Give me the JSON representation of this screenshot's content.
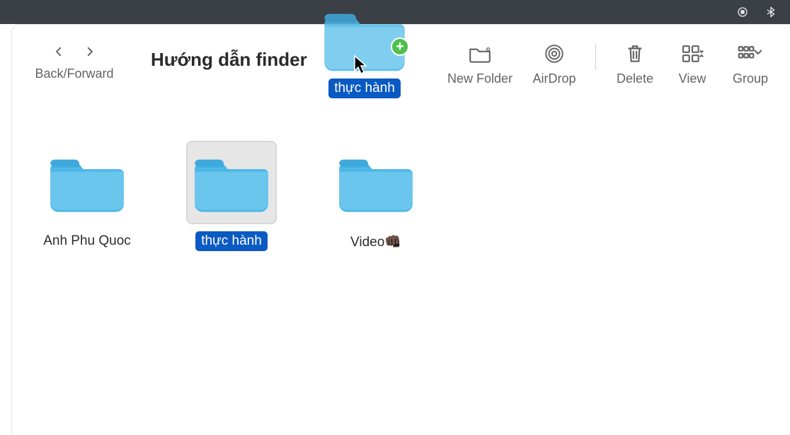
{
  "menubar": {},
  "toolbar": {
    "nav_label": "Back/Forward",
    "title": "Hướng dẫn finder",
    "items": {
      "new_folder": "New Folder",
      "airdrop": "AirDrop",
      "delete": "Delete",
      "view": "View",
      "group": "Group"
    }
  },
  "folders": [
    {
      "name": "Anh Phu Quoc",
      "selected": false
    },
    {
      "name": "thực hành",
      "selected": true
    },
    {
      "name": "Video👊🏿",
      "selected": false
    }
  ],
  "drag": {
    "label": "thực hành"
  },
  "colors": {
    "folder_light": "#8fd6f4",
    "folder_dark": "#4db7e8",
    "selection_bg": "#0a5ac4"
  }
}
